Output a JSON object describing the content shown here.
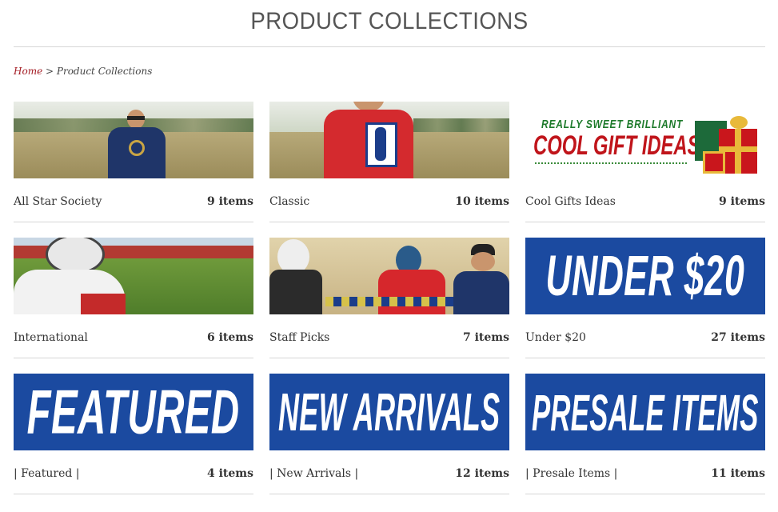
{
  "page": {
    "title": "PRODUCT COLLECTIONS"
  },
  "breadcrumb": {
    "home": "Home",
    "separator": ">",
    "current": "Product Collections"
  },
  "collections": [
    {
      "name": "All Star Society",
      "count": "9 items"
    },
    {
      "name": "Classic",
      "count": "10 items"
    },
    {
      "name": "Cool Gifts Ideas",
      "count": "9 items"
    },
    {
      "name": "International",
      "count": "6 items"
    },
    {
      "name": "Staff Picks",
      "count": "7 items"
    },
    {
      "name": "Under $20",
      "count": "27 items"
    },
    {
      "name": "| Featured |",
      "count": "4 items"
    },
    {
      "name": "| New Arrivals |",
      "count": "12 items"
    },
    {
      "name": "| Presale Items |",
      "count": "11 items"
    }
  ],
  "banners": {
    "gift_small": "REALLY  SWEET  BRILLIANT",
    "gift_big": "COOL GIFT IDEAS",
    "under20": "UNDER $20",
    "featured": "FEATURED",
    "new_arrivals": "NEW ARRIVALS",
    "presale": "PRESALE ITEMS"
  },
  "colors": {
    "banner_blue": "#1b4aa0",
    "link_red": "#a41c24",
    "rule": "#d7d7d7"
  }
}
